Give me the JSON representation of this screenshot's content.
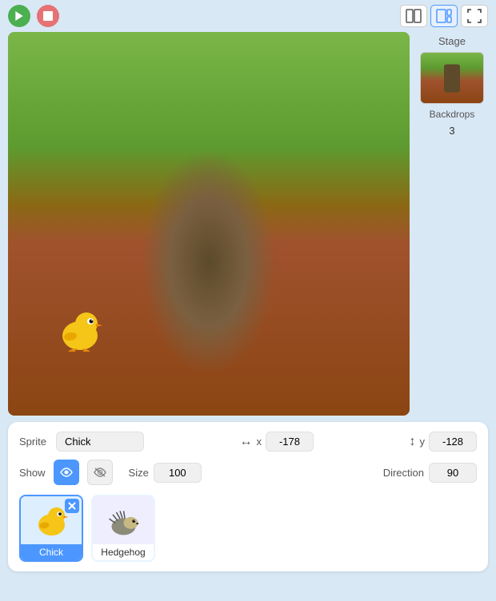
{
  "topbar": {
    "green_flag_label": "Green Flag",
    "stop_label": "Stop",
    "layout_split_label": "Split Layout",
    "layout_stage_label": "Stage Layout",
    "fullscreen_label": "Fullscreen"
  },
  "sprite_panel": {
    "sprite_label": "Sprite",
    "sprite_name": "Chick",
    "x_icon": "↔",
    "x_label": "x",
    "x_value": "-178",
    "y_icon": "↕",
    "y_label": "y",
    "y_value": "-128",
    "show_label": "Show",
    "size_label": "Size",
    "size_value": "100",
    "direction_label": "Direction",
    "direction_value": "90"
  },
  "sprites": [
    {
      "name": "Chick",
      "selected": true
    },
    {
      "name": "Hedgehog",
      "selected": false
    }
  ],
  "stage_sidebar": {
    "label": "Stage",
    "backdrops_label": "Backdrops",
    "backdrops_count": "3"
  },
  "colors": {
    "accent": "#4c97ff",
    "bg": "#d9e8f5",
    "panel_bg": "#ffffff"
  }
}
